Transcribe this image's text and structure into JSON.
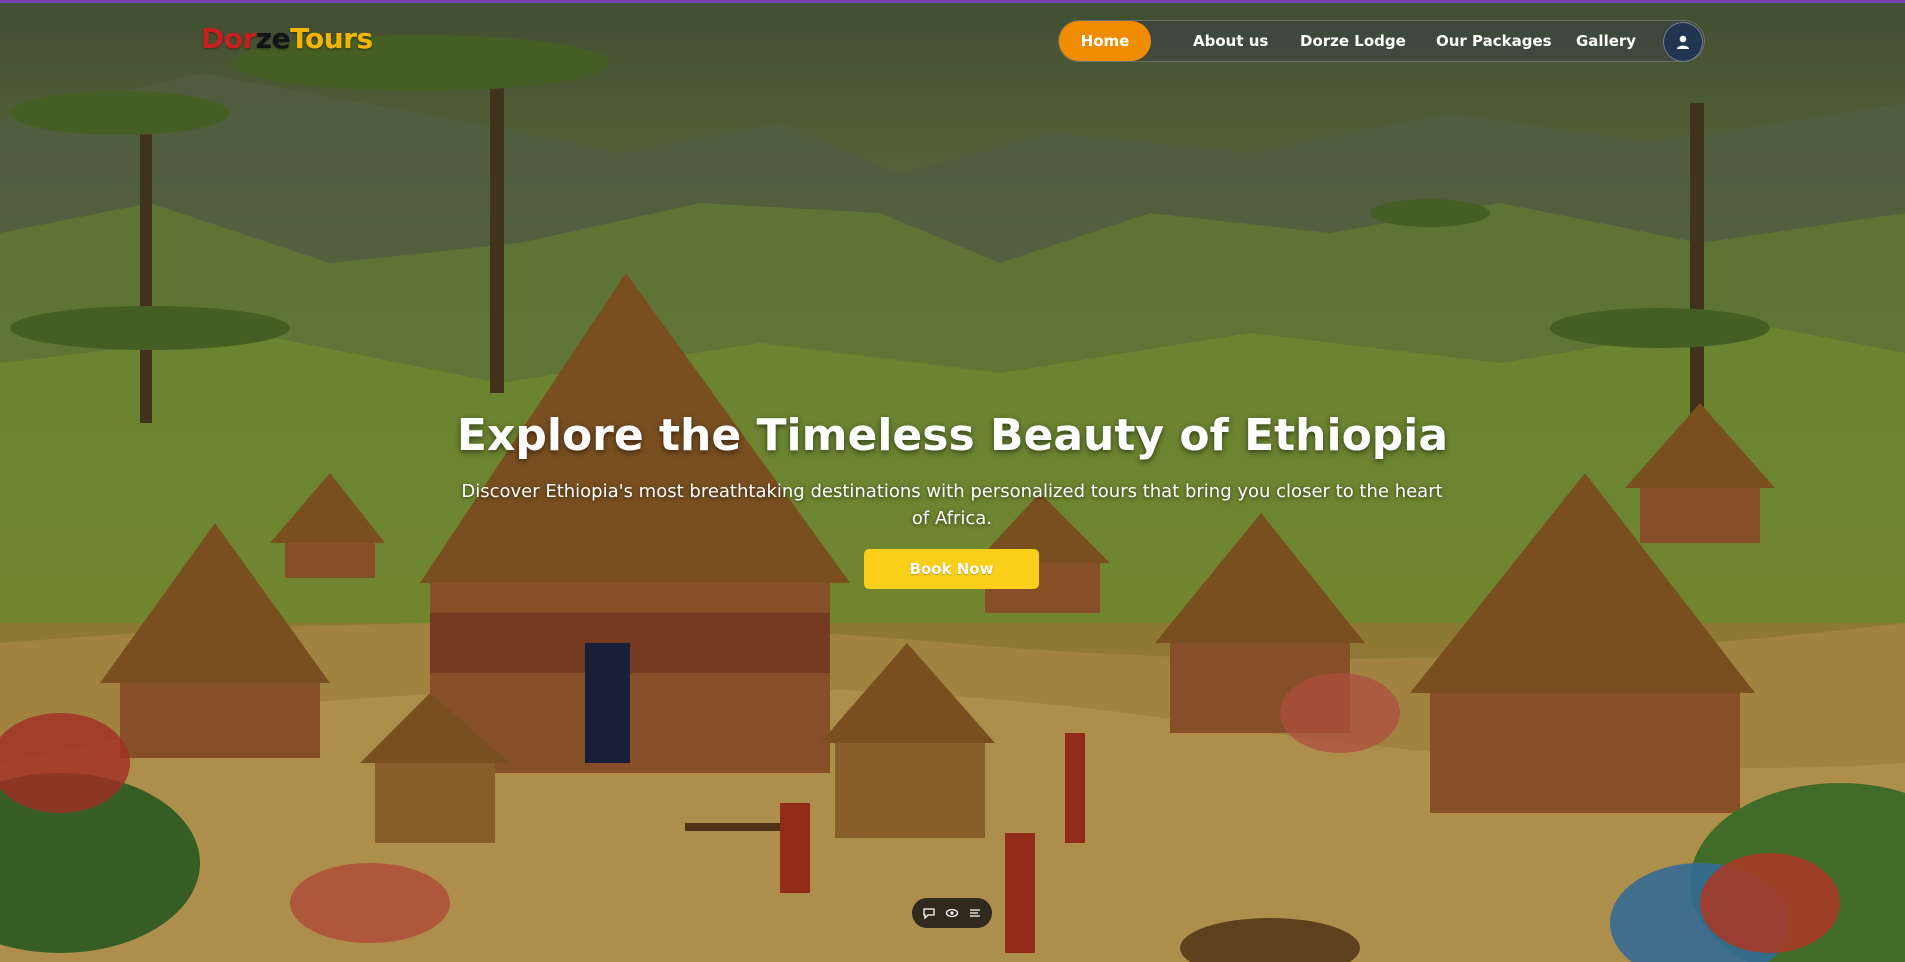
{
  "brand": {
    "part1": "Dor",
    "part2": "ze",
    "part3": "Tours",
    "colors": {
      "part1": "#c81e1e",
      "part2": "#141414",
      "part3": "#f4b400"
    }
  },
  "nav": {
    "items": [
      {
        "label": "Home",
        "active": true
      },
      {
        "label": "About us"
      },
      {
        "label": "Dorze Lodge"
      },
      {
        "label": "Our Packages"
      },
      {
        "label": "Gallery"
      }
    ],
    "account_icon": "user-icon",
    "active_color": "#f08c00"
  },
  "hero": {
    "title": "Explore the Timeless Beauty of Ethiopia",
    "subtitle": "Discover Ethiopia's most breathtaking destinations with personalized tours that bring you closer to the heart of Africa.",
    "cta_label": "Book Now",
    "cta_color": "#f9cf1a",
    "background": "illustration of thatched Dorze huts in a green Ethiopian highland village"
  },
  "floating_toolbar": {
    "icons": [
      "comment-icon",
      "eye-icon",
      "menu-lines-icon"
    ]
  }
}
